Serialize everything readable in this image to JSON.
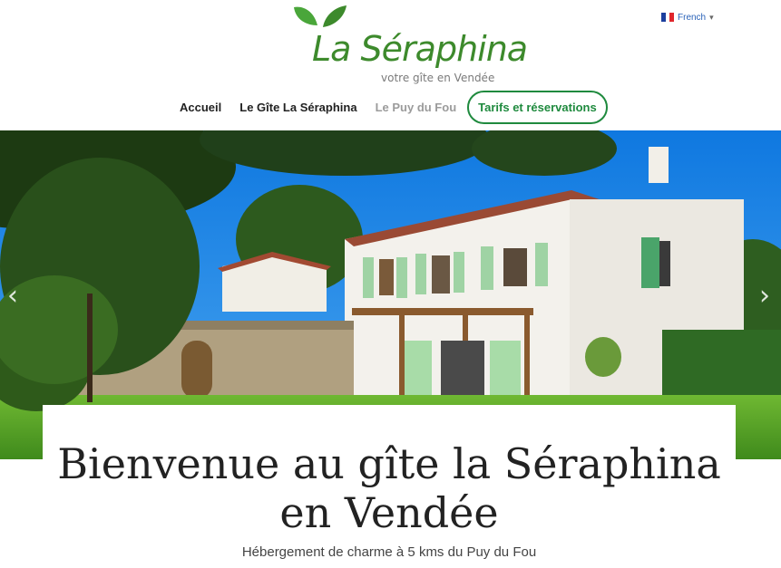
{
  "header": {
    "logo_name": "La Séraphina",
    "logo_tagline": "votre gîte en Vendée",
    "language": "French",
    "language_caret": "▾"
  },
  "nav": {
    "items": [
      {
        "label": "Accueil"
      },
      {
        "label": "Le Gîte La Séraphina"
      },
      {
        "label": "Le Puy du Fou"
      },
      {
        "label": "Tarifs et réservations"
      }
    ]
  },
  "slider": {
    "prev": "‹",
    "next": "›"
  },
  "content": {
    "title_line1": "Bienvenue au gîte la Séraphina",
    "title_line2": "en Vendée",
    "subtitle": "Hébergement de charme à 5 kms du Puy du Fou"
  },
  "colors": {
    "brand_green": "#3d8a2c",
    "cta_green": "#1f8a3e",
    "sky": "#1f86e8"
  }
}
